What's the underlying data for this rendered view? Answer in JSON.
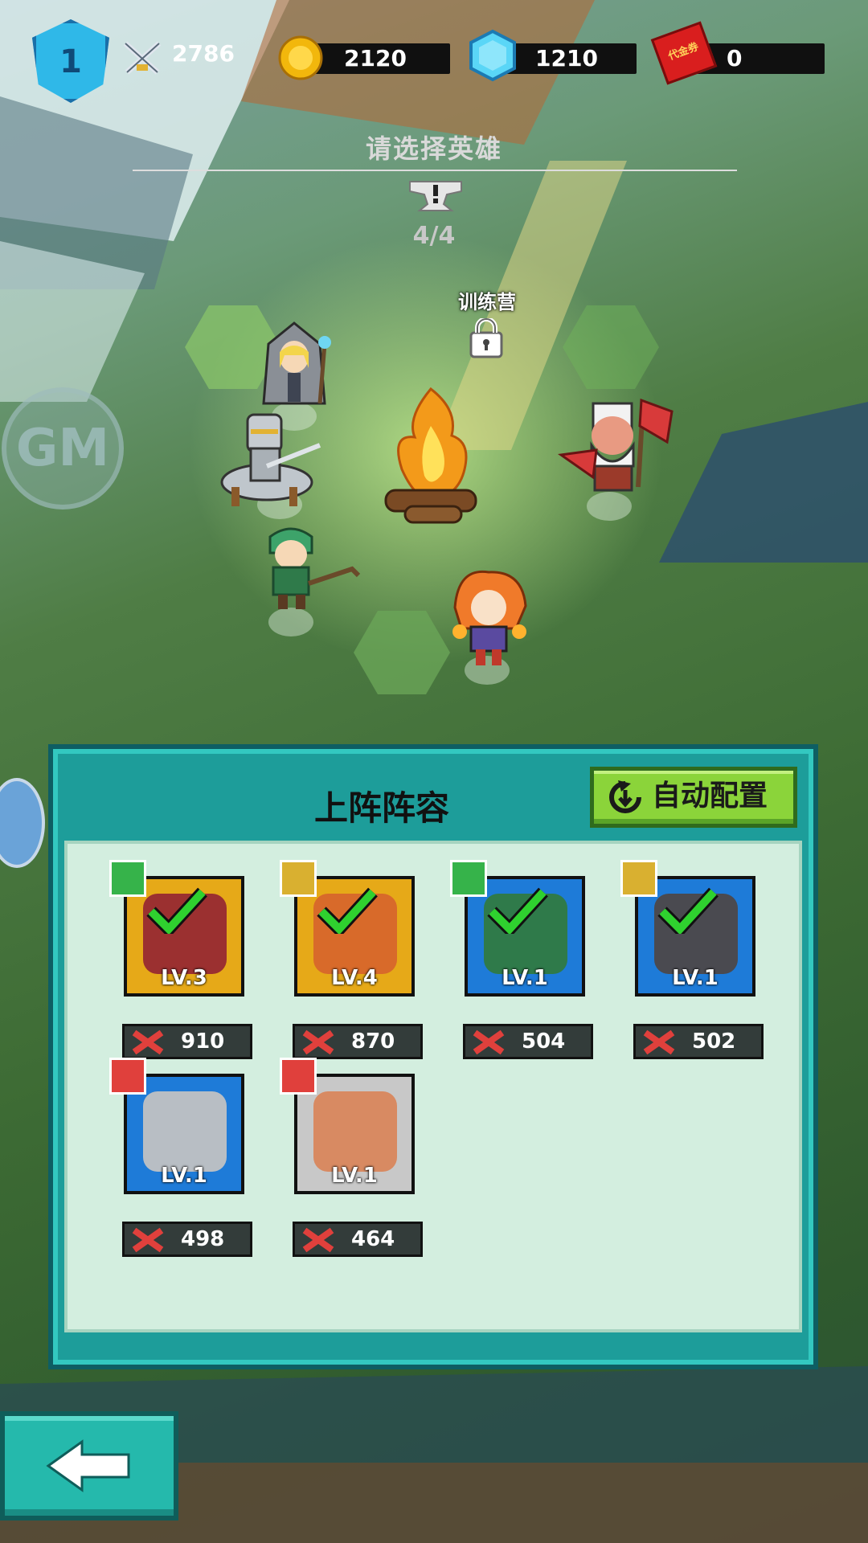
{
  "hud": {
    "level": "1",
    "power": "2786",
    "gold": "2120",
    "gems": "1210",
    "voucher": "0",
    "voucher_icon_text": "代金券"
  },
  "header": {
    "title": "请选择英雄",
    "count": "4/4",
    "camp_label": "训练营"
  },
  "gm_label": "GM",
  "panel": {
    "title": "上阵阵容",
    "auto_button_label": "自动配置",
    "heroes": [
      {
        "level": "LV.3",
        "power": "910",
        "class": "green",
        "frame": "gold",
        "selected": true
      },
      {
        "level": "LV.4",
        "power": "870",
        "class": "yellow",
        "frame": "gold",
        "selected": true
      },
      {
        "level": "LV.1",
        "power": "504",
        "class": "green",
        "frame": "blue",
        "selected": true
      },
      {
        "level": "LV.1",
        "power": "502",
        "class": "yellow",
        "frame": "blue",
        "selected": true
      },
      {
        "level": "LV.1",
        "power": "498",
        "class": "red",
        "frame": "blue",
        "selected": false
      },
      {
        "level": "LV.1",
        "power": "464",
        "class": "red",
        "frame": "white",
        "selected": false
      }
    ]
  },
  "colors": {
    "panel": "#1d9d9a",
    "panel_inner": "#d3eedf",
    "auto_button": "#8bd43a",
    "check": "#2fd12f"
  },
  "icons": {
    "power": "crossed-swords-icon",
    "gold": "gold-coin-icon",
    "gems": "blue-gem-icon",
    "voucher": "red-ticket-icon",
    "hero_power": "red-fist-icon",
    "auto": "refresh-arrow-icon",
    "back": "left-arrow-icon"
  }
}
